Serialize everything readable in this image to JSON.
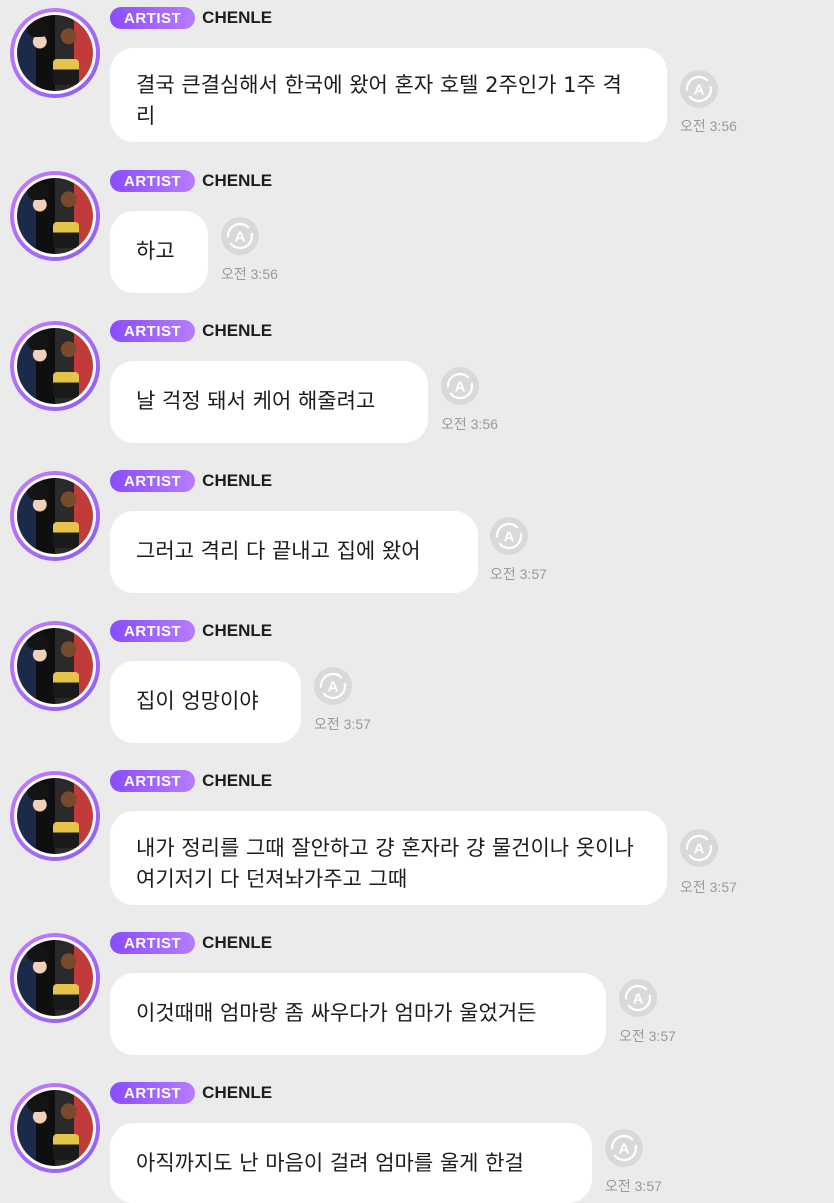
{
  "badge_label": "ARTIST",
  "sender_name": "CHENLE",
  "avatar_icon": "profile-photo",
  "translate_icon": "translate-a-icon",
  "messages": [
    {
      "text": "결국 큰결심해서 한국에 왔어 혼자 호텔 2주인가 1주 격리",
      "time": "오전 3:56"
    },
    {
      "text": "하고",
      "time": "오전 3:56"
    },
    {
      "text": "날 걱정 돼서 케어 해줄려고",
      "time": "오전 3:56"
    },
    {
      "text": "그러고 격리 다 끝내고 집에 왔어",
      "time": "오전 3:57"
    },
    {
      "text": "집이 엉망이야",
      "time": "오전 3:57"
    },
    {
      "text": "내가 정리를 그때 잘안하고 걍 혼자라 걍 물건이나 옷이나 여기저기 다 던져놔가주고 그때",
      "time": "오전 3:57"
    },
    {
      "text": "이것때매 엄마랑 좀 싸우다가 엄마가 울었거든",
      "time": "오전 3:57"
    },
    {
      "text": "아직까지도 난 마음이 걸려 엄마를 울게 한걸",
      "time": "오전 3:57"
    }
  ]
}
